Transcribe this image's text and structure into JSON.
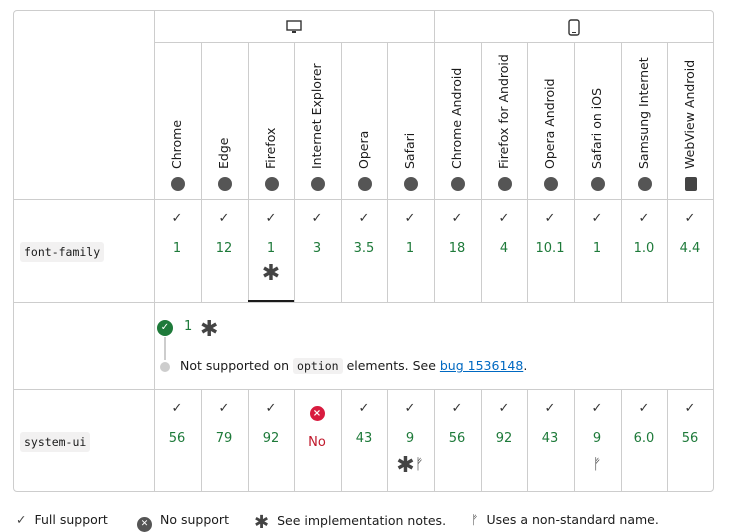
{
  "platforms": {
    "desktop_icon": "desktop-icon",
    "mobile_icon": "mobile-icon"
  },
  "browsers": [
    {
      "name": "Chrome",
      "icon": "chrome-icon"
    },
    {
      "name": "Edge",
      "icon": "edge-icon"
    },
    {
      "name": "Firefox",
      "icon": "firefox-icon"
    },
    {
      "name": "Internet Explorer",
      "icon": "ie-icon"
    },
    {
      "name": "Opera",
      "icon": "opera-icon"
    },
    {
      "name": "Safari",
      "icon": "safari-icon"
    },
    {
      "name": "Chrome Android",
      "icon": "chrome-icon"
    },
    {
      "name": "Firefox for Android",
      "icon": "firefox-icon"
    },
    {
      "name": "Opera Android",
      "icon": "opera-icon"
    },
    {
      "name": "Safari on iOS",
      "icon": "safari-icon"
    },
    {
      "name": "Samsung Internet",
      "icon": "samsung-icon"
    },
    {
      "name": "WebView Android",
      "icon": "android-icon"
    }
  ],
  "rows": [
    {
      "feature": "font-family",
      "cells": [
        {
          "mark": "✓",
          "version": "1"
        },
        {
          "mark": "✓",
          "version": "12"
        },
        {
          "mark": "✓",
          "version": "1",
          "note": "✱"
        },
        {
          "mark": "✓",
          "version": "3"
        },
        {
          "mark": "✓",
          "version": "3.5"
        },
        {
          "mark": "✓",
          "version": "1"
        },
        {
          "mark": "✓",
          "version": "18"
        },
        {
          "mark": "✓",
          "version": "4"
        },
        {
          "mark": "✓",
          "version": "10.1"
        },
        {
          "mark": "✓",
          "version": "1"
        },
        {
          "mark": "✓",
          "version": "1.0"
        },
        {
          "mark": "✓",
          "version": "4.4"
        }
      ]
    },
    {
      "feature": "system-ui",
      "cells": [
        {
          "mark": "✓",
          "version": "56"
        },
        {
          "mark": "✓",
          "version": "79"
        },
        {
          "mark": "✓",
          "version": "92"
        },
        {
          "mark": "×",
          "version": "No",
          "unsupported": true
        },
        {
          "mark": "✓",
          "version": "43"
        },
        {
          "mark": "✓",
          "version": "9",
          "note": "✱",
          "alt": "ᚠ"
        },
        {
          "mark": "✓",
          "version": "56"
        },
        {
          "mark": "✓",
          "version": "92"
        },
        {
          "mark": "✓",
          "version": "43"
        },
        {
          "mark": "✓",
          "version": "9",
          "alt": "ᚠ"
        },
        {
          "mark": "✓",
          "version": "6.0"
        },
        {
          "mark": "✓",
          "version": "56"
        }
      ]
    }
  ],
  "detail": {
    "version": "1",
    "note_prefix": "Not supported on",
    "note_code": "option",
    "note_middle": "elements. See",
    "note_link": "bug 1536148",
    "note_suffix": "."
  },
  "legend": {
    "full_support": "Full support",
    "no_support": "No support",
    "impl_notes": "See implementation notes.",
    "nonstandard": "Uses a non-standard name."
  }
}
